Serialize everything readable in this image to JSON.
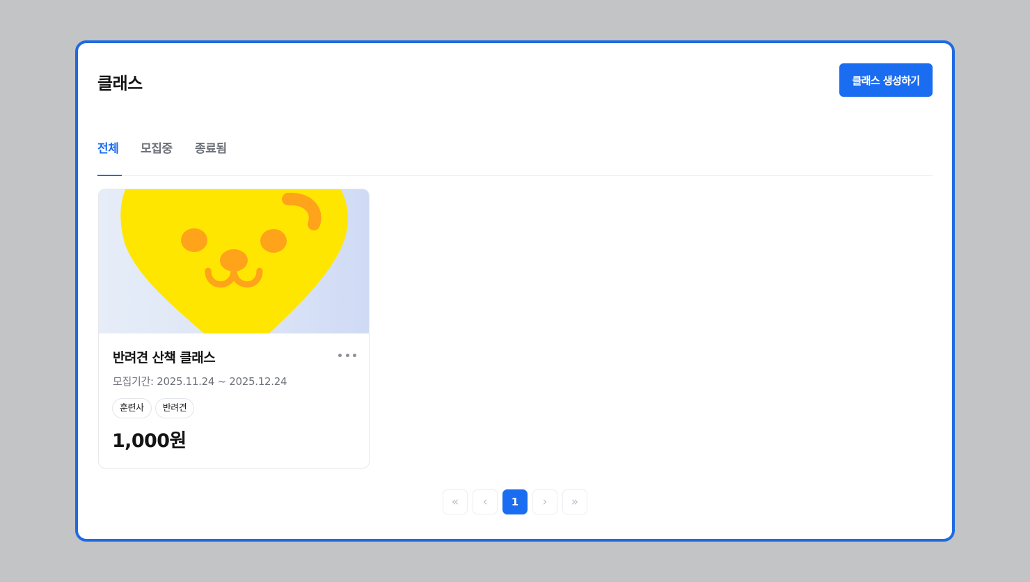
{
  "header": {
    "title": "클래스",
    "create_label": "클래스 생성하기"
  },
  "tabs": [
    {
      "label": "전체",
      "active": true
    },
    {
      "label": "모집중",
      "active": false
    },
    {
      "label": "종료됨",
      "active": false
    }
  ],
  "cards": [
    {
      "title": "반려견 산책 클래스",
      "period": "모집기간: 2025.11.24 ~ 2025.12.24",
      "tags": [
        "훈련사",
        "반려견"
      ],
      "price": "1,000원",
      "image": "yellow-dog-heart-illustration"
    }
  ],
  "pagination": {
    "first": "«",
    "prev": "‹",
    "current": "1",
    "next": "›",
    "last": "»"
  },
  "colors": {
    "accent": "#1a6cf0",
    "border": "#1f6ae0",
    "backdrop": "#c3c4c6",
    "illustration_yellow": "#ffe600",
    "illustration_orange": "#ffa31a"
  },
  "icons": [
    "more-horizontal-icon",
    "double-chevron-left-icon",
    "chevron-left-icon",
    "chevron-right-icon",
    "double-chevron-right-icon"
  ]
}
